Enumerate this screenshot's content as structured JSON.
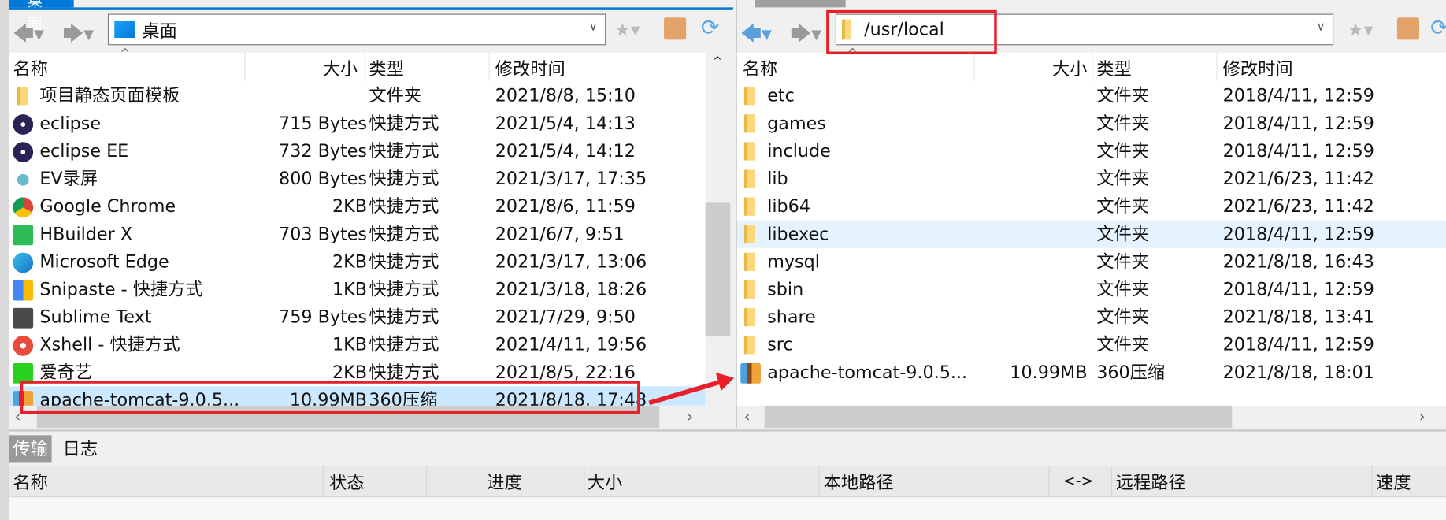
{
  "left": {
    "tab": "桌面",
    "path": "桌面",
    "columns": [
      "名称",
      "大小",
      "类型",
      "修改时间"
    ],
    "rows": [
      {
        "name": "项目静态页面模板",
        "size": "",
        "type": "文件夹",
        "modified": "2021/8/8, 15:10",
        "icon": "folder-icon"
      },
      {
        "name": "eclipse",
        "size": "715 Bytes",
        "type": "快捷方式",
        "modified": "2021/5/4, 14:13",
        "icon": "eclipse-icon"
      },
      {
        "name": "eclipse EE",
        "size": "732 Bytes",
        "type": "快捷方式",
        "modified": "2021/5/4, 14:12",
        "icon": "eclipse-icon"
      },
      {
        "name": "EV录屏",
        "size": "800 Bytes",
        "type": "快捷方式",
        "modified": "2021/3/17, 17:35",
        "icon": "ev-icon"
      },
      {
        "name": "Google Chrome",
        "size": "2KB",
        "type": "快捷方式",
        "modified": "2021/8/6, 11:59",
        "icon": "chrome-icon"
      },
      {
        "name": "HBuilder X",
        "size": "703 Bytes",
        "type": "快捷方式",
        "modified": "2021/6/7, 9:51",
        "icon": "hbuilder-icon"
      },
      {
        "name": "Microsoft Edge",
        "size": "2KB",
        "type": "快捷方式",
        "modified": "2021/3/17, 13:06",
        "icon": "edge-icon"
      },
      {
        "name": "Snipaste - 快捷方式",
        "size": "1KB",
        "type": "快捷方式",
        "modified": "2021/3/18, 18:26",
        "icon": "snipaste-icon"
      },
      {
        "name": "Sublime Text",
        "size": "759 Bytes",
        "type": "快捷方式",
        "modified": "2021/7/29, 9:50",
        "icon": "sublime-icon"
      },
      {
        "name": "Xshell - 快捷方式",
        "size": "1KB",
        "type": "快捷方式",
        "modified": "2021/4/11, 19:56",
        "icon": "xshell-icon"
      },
      {
        "name": "爱奇艺",
        "size": "2KB",
        "type": "快捷方式",
        "modified": "2021/8/5, 22:16",
        "icon": "iqiyi-icon"
      },
      {
        "name": "apache-tomcat-9.0.5...",
        "size": "10.99MB",
        "type": "360压缩",
        "modified": "2021/8/18, 17:48",
        "icon": "archive-icon",
        "selected": true
      }
    ]
  },
  "right": {
    "path": "/usr/local",
    "columns": [
      "名称",
      "大小",
      "类型",
      "修改时间"
    ],
    "rows": [
      {
        "name": "etc",
        "size": "",
        "type": "文件夹",
        "modified": "2018/4/11, 12:59",
        "icon": "folder-icon"
      },
      {
        "name": "games",
        "size": "",
        "type": "文件夹",
        "modified": "2018/4/11, 12:59",
        "icon": "folder-icon"
      },
      {
        "name": "include",
        "size": "",
        "type": "文件夹",
        "modified": "2018/4/11, 12:59",
        "icon": "folder-icon"
      },
      {
        "name": "lib",
        "size": "",
        "type": "文件夹",
        "modified": "2021/6/23, 11:42",
        "icon": "folder-icon"
      },
      {
        "name": "lib64",
        "size": "",
        "type": "文件夹",
        "modified": "2021/6/23, 11:42",
        "icon": "folder-icon"
      },
      {
        "name": "libexec",
        "size": "",
        "type": "文件夹",
        "modified": "2018/4/11, 12:59",
        "icon": "folder-icon",
        "hover": true
      },
      {
        "name": "mysql",
        "size": "",
        "type": "文件夹",
        "modified": "2021/8/18, 16:43",
        "icon": "folder-icon"
      },
      {
        "name": "sbin",
        "size": "",
        "type": "文件夹",
        "modified": "2018/4/11, 12:59",
        "icon": "folder-icon"
      },
      {
        "name": "share",
        "size": "",
        "type": "文件夹",
        "modified": "2021/8/18, 13:41",
        "icon": "folder-icon"
      },
      {
        "name": "src",
        "size": "",
        "type": "文件夹",
        "modified": "2018/4/11, 12:59",
        "icon": "folder-icon"
      },
      {
        "name": "apache-tomcat-9.0.5...",
        "size": "10.99MB",
        "type": "360压缩",
        "modified": "2021/8/18, 18:01",
        "icon": "archive-icon"
      }
    ]
  },
  "bottom": {
    "tabs": [
      {
        "label": "传输",
        "active": true
      },
      {
        "label": "日志",
        "active": false
      }
    ],
    "columns": [
      "名称",
      "状态",
      "进度",
      "大小",
      "本地路径",
      "<->",
      "远程路径",
      "速度"
    ]
  },
  "colors": {
    "accent": "#0078d7",
    "selection": "#cce8ff",
    "annotation": "#e8202a"
  }
}
